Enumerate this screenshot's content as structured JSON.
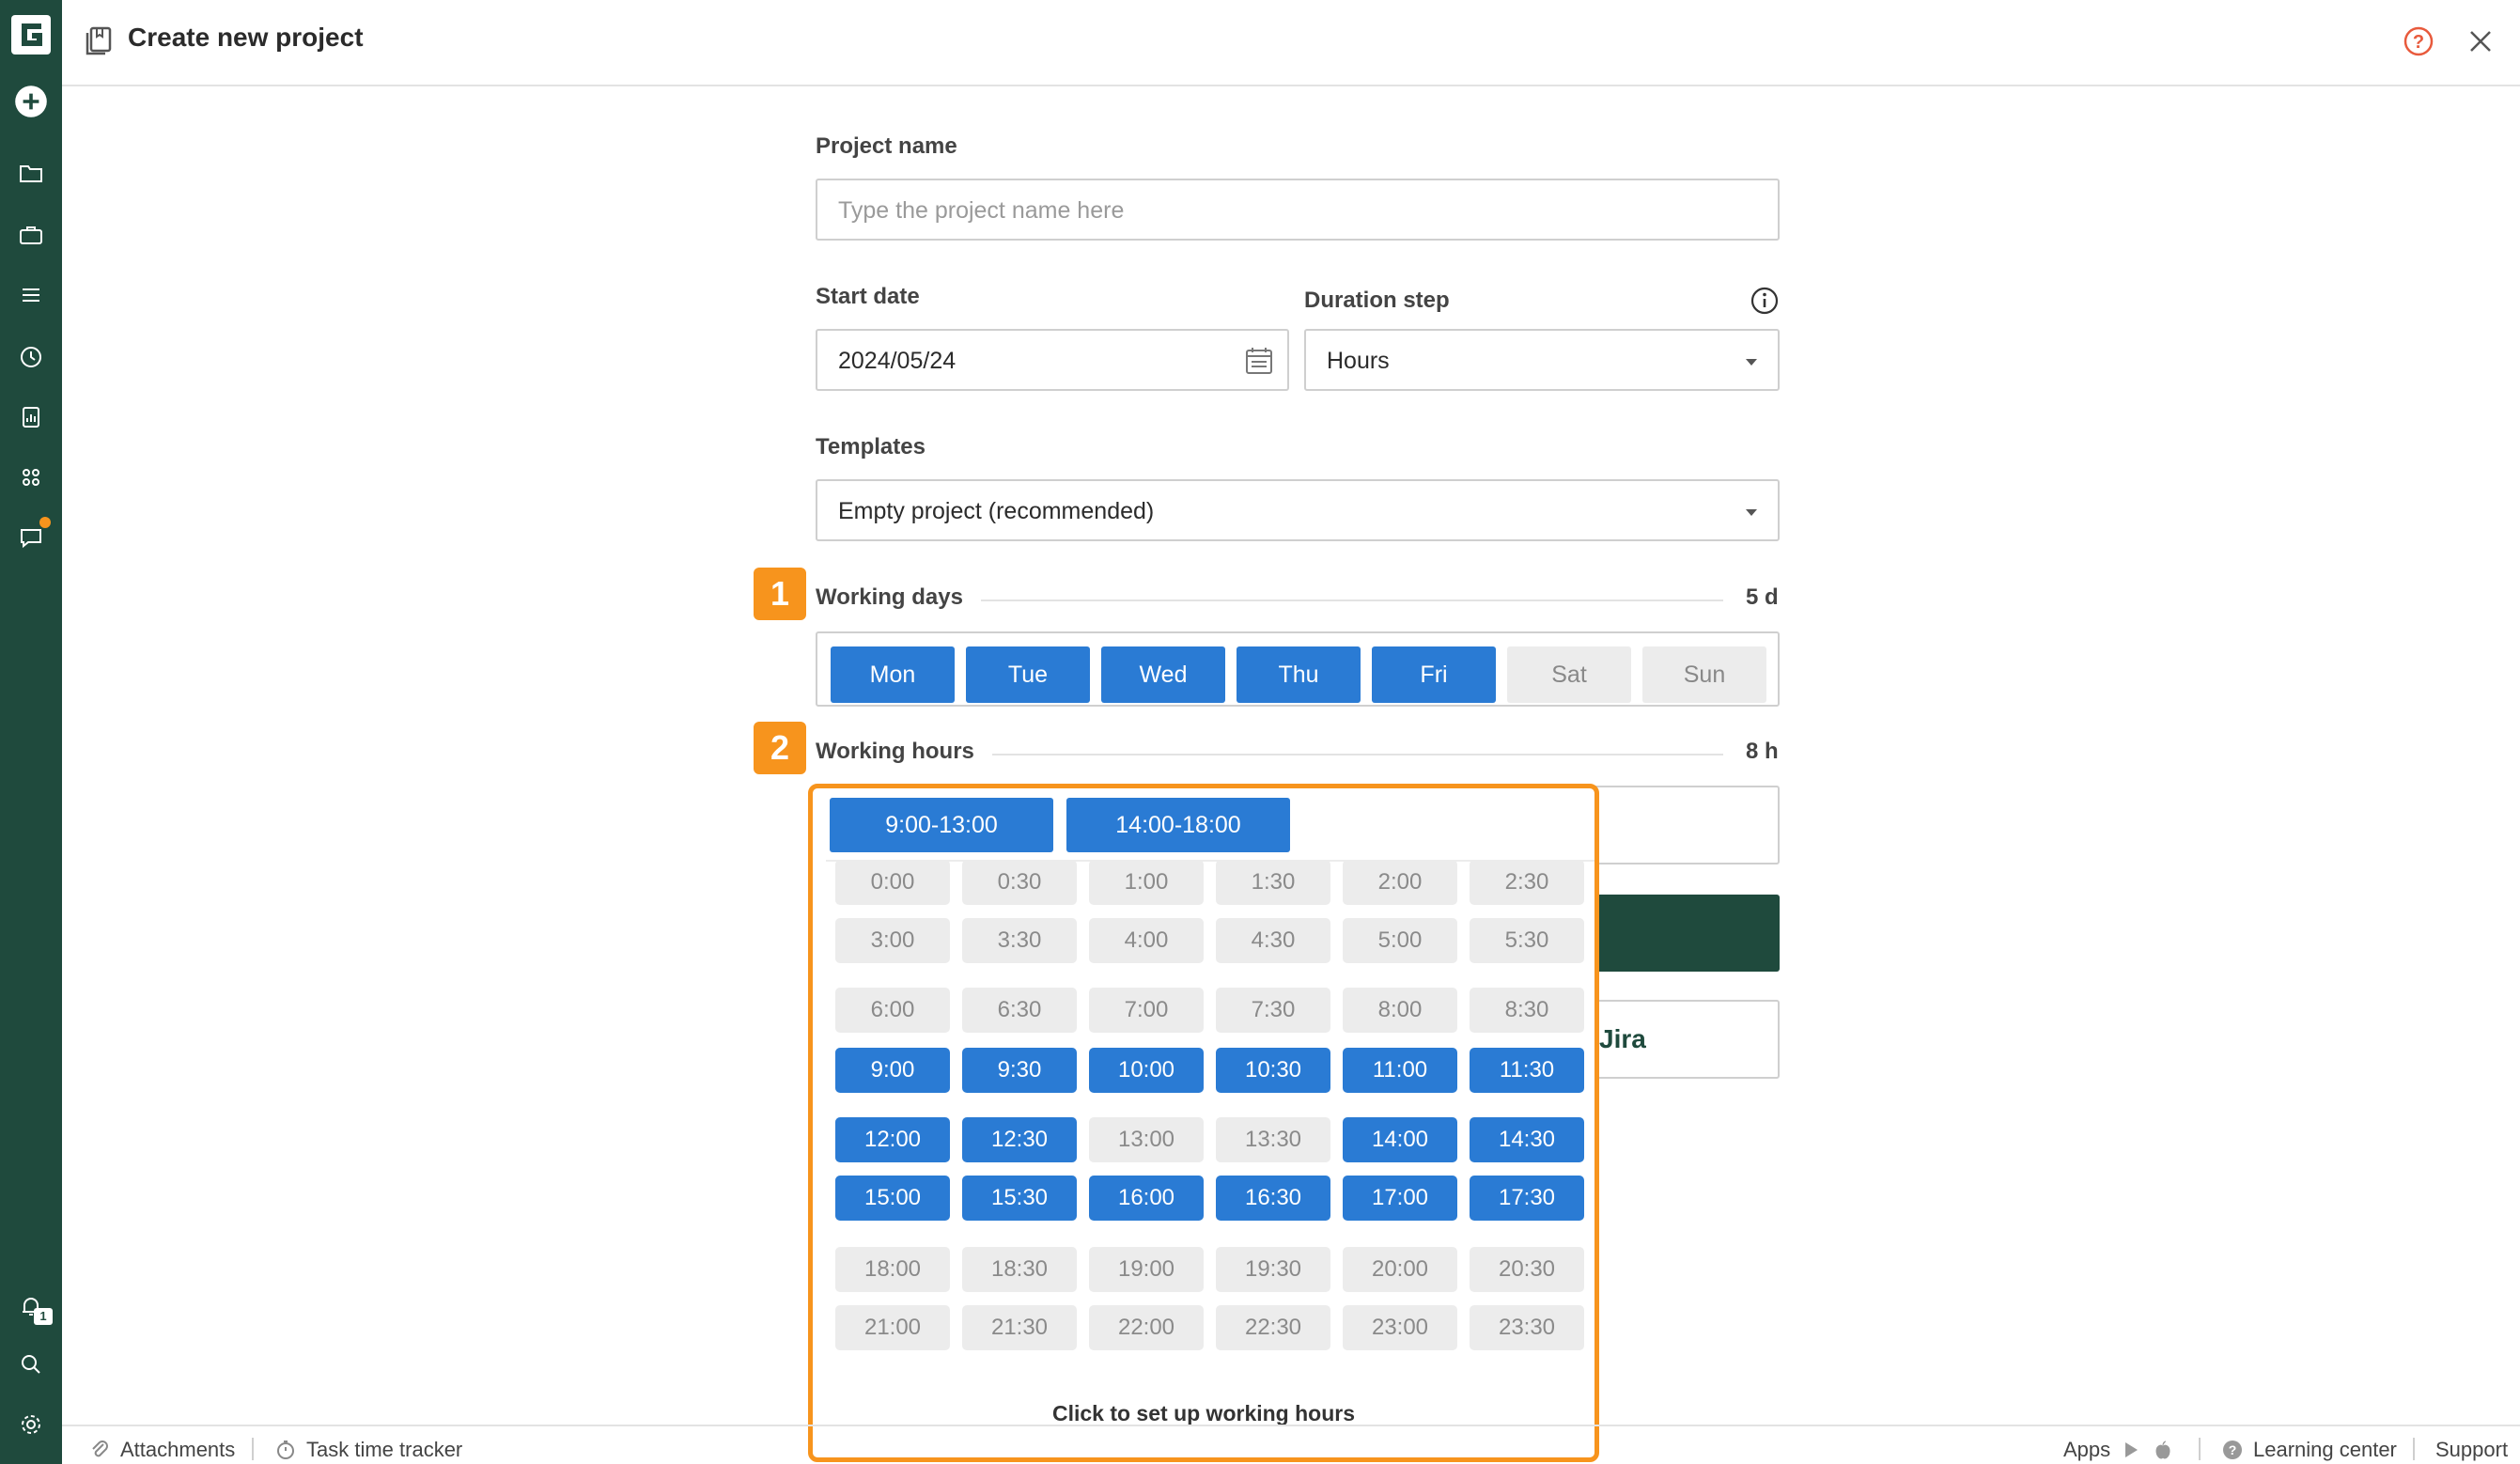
{
  "header": {
    "title": "Create new project"
  },
  "form": {
    "project_name_label": "Project name",
    "project_name_placeholder": "Type the project name here",
    "start_date_label": "Start date",
    "start_date_value": "2024/05/24",
    "duration_step_label": "Duration step",
    "duration_step_value": "Hours",
    "templates_label": "Templates",
    "templates_value": "Empty project (recommended)",
    "working_days": {
      "badge": "1",
      "label": "Working days",
      "total": "5 d",
      "days": [
        {
          "label": "Mon",
          "selected": true
        },
        {
          "label": "Tue",
          "selected": true
        },
        {
          "label": "Wed",
          "selected": true
        },
        {
          "label": "Thu",
          "selected": true
        },
        {
          "label": "Fri",
          "selected": true
        },
        {
          "label": "Sat",
          "selected": false
        },
        {
          "label": "Sun",
          "selected": false
        }
      ]
    },
    "working_hours": {
      "badge": "2",
      "label": "Working hours",
      "total": "8 h"
    },
    "import_jira_fragment": "Jira"
  },
  "hours_popup": {
    "ranges": [
      "9:00-13:00",
      "14:00-18:00"
    ],
    "slots": [
      {
        "label": "0:00",
        "selected": false
      },
      {
        "label": "0:30",
        "selected": false
      },
      {
        "label": "1:00",
        "selected": false
      },
      {
        "label": "1:30",
        "selected": false
      },
      {
        "label": "2:00",
        "selected": false
      },
      {
        "label": "2:30",
        "selected": false
      },
      {
        "label": "3:00",
        "selected": false
      },
      {
        "label": "3:30",
        "selected": false
      },
      {
        "label": "4:00",
        "selected": false
      },
      {
        "label": "4:30",
        "selected": false
      },
      {
        "label": "5:00",
        "selected": false
      },
      {
        "label": "5:30",
        "selected": false
      },
      {
        "label": "6:00",
        "selected": false
      },
      {
        "label": "6:30",
        "selected": false
      },
      {
        "label": "7:00",
        "selected": false
      },
      {
        "label": "7:30",
        "selected": false
      },
      {
        "label": "8:00",
        "selected": false
      },
      {
        "label": "8:30",
        "selected": false
      },
      {
        "label": "9:00",
        "selected": true
      },
      {
        "label": "9:30",
        "selected": true
      },
      {
        "label": "10:00",
        "selected": true
      },
      {
        "label": "10:30",
        "selected": true
      },
      {
        "label": "11:00",
        "selected": true
      },
      {
        "label": "11:30",
        "selected": true
      },
      {
        "label": "12:00",
        "selected": true
      },
      {
        "label": "12:30",
        "selected": true
      },
      {
        "label": "13:00",
        "selected": false
      },
      {
        "label": "13:30",
        "selected": false
      },
      {
        "label": "14:00",
        "selected": true
      },
      {
        "label": "14:30",
        "selected": true
      },
      {
        "label": "15:00",
        "selected": true
      },
      {
        "label": "15:30",
        "selected": true
      },
      {
        "label": "16:00",
        "selected": true
      },
      {
        "label": "16:30",
        "selected": true
      },
      {
        "label": "17:00",
        "selected": true
      },
      {
        "label": "17:30",
        "selected": true
      },
      {
        "label": "18:00",
        "selected": false
      },
      {
        "label": "18:30",
        "selected": false
      },
      {
        "label": "19:00",
        "selected": false
      },
      {
        "label": "19:30",
        "selected": false
      },
      {
        "label": "20:00",
        "selected": false
      },
      {
        "label": "20:30",
        "selected": false
      },
      {
        "label": "21:00",
        "selected": false
      },
      {
        "label": "21:30",
        "selected": false
      },
      {
        "label": "22:00",
        "selected": false
      },
      {
        "label": "22:30",
        "selected": false
      },
      {
        "label": "23:00",
        "selected": false
      },
      {
        "label": "23:30",
        "selected": false
      }
    ],
    "footer_text": "Click to set up working hours"
  },
  "footer": {
    "attachments": "Attachments",
    "time_tracker": "Task time tracker",
    "apps": "Apps",
    "learning_center": "Learning center",
    "support": "Support"
  },
  "colors": {
    "sidebar": "#1f4a3d",
    "accent_blue": "#2a7bd4",
    "highlight_orange": "#f7941d"
  }
}
